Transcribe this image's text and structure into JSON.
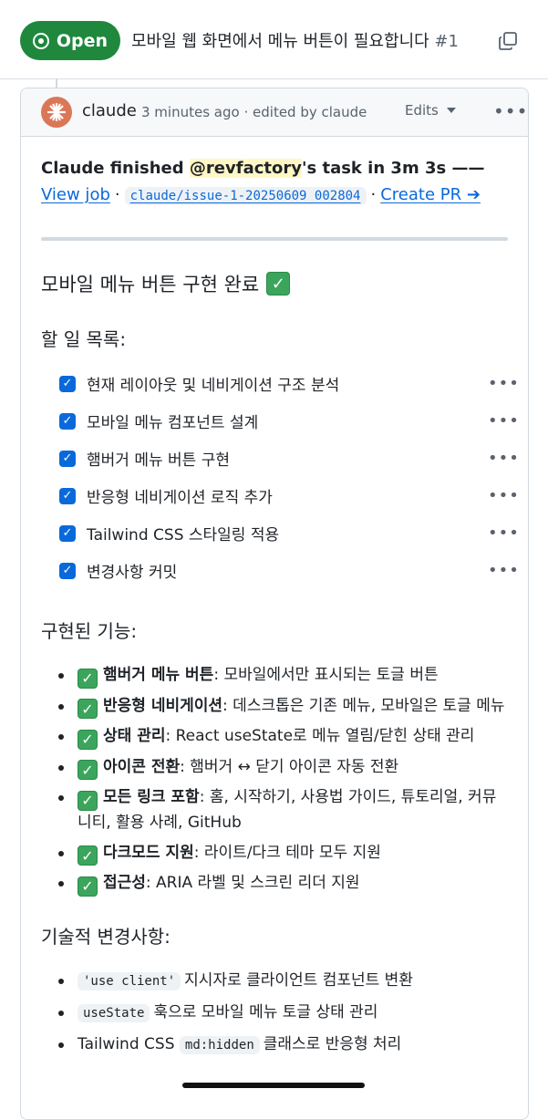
{
  "header": {
    "status_label": "Open",
    "issue_title": "모바일 웹 화면에서 메뉴 버튼이 필요합니다",
    "issue_number": "#1"
  },
  "comment": {
    "author": "claude",
    "time": "3 minutes ago",
    "edited": "· edited by claude",
    "edits_label": "Edits",
    "summary": {
      "prefix": "Claude finished ",
      "mention": "@revfactory",
      "suffix": "'s task in 3m 3s —— ",
      "view_job": "View job",
      "branch": "claude/issue-1-20250609_002804",
      "create_pr": "Create PR ➔"
    },
    "heading_done": "모바일 메뉴 버튼 구현 완료",
    "heading_todo": "할 일 목록:",
    "tasks": [
      "현재 레이아웃 및 네비게이션 구조 분석",
      "모바일 메뉴 컴포넌트 설계",
      "햄버거 메뉴 버튼 구현",
      "반응형 네비게이션 로직 추가",
      "Tailwind CSS 스타일링 적용",
      "변경사항 커밋"
    ],
    "heading_features": "구현된 기능:",
    "features": [
      {
        "title": "햄버거 메뉴 버튼",
        "desc": ": 모바일에서만 표시되는 토글 버튼"
      },
      {
        "title": "반응형 네비게이션",
        "desc": ": 데스크톱은 기존 메뉴, 모바일은 토글 메뉴"
      },
      {
        "title": "상태 관리",
        "desc": ": React useState로 메뉴 열림/닫힌 상태 관리"
      },
      {
        "title": "아이콘 전환",
        "desc": ": 햄버거 ↔ 닫기 아이콘 자동 전환"
      },
      {
        "title": "모든 링크 포함",
        "desc": ": 홈, 시작하기, 사용법 가이드, 튜토리얼, 커뮤니티, 활용 사례, GitHub"
      },
      {
        "title": "다크모드 지원",
        "desc": ": 라이트/다크 테마 모두 지원"
      },
      {
        "title": "접근성",
        "desc": ": ARIA 라벨 및 스크린 리더 지원"
      }
    ],
    "heading_tech": "기술적 변경사항:",
    "tech": [
      {
        "code": "'use client'",
        "text": "지시자로 클라이언트 컴포넌트 변환"
      },
      {
        "code": "useState",
        "text": "훅으로 모바일 메뉴 토글 상태 관리"
      },
      {
        "prefix": "Tailwind CSS ",
        "code": "md:hidden",
        "text": "클래스로 반응형 처리"
      }
    ]
  }
}
